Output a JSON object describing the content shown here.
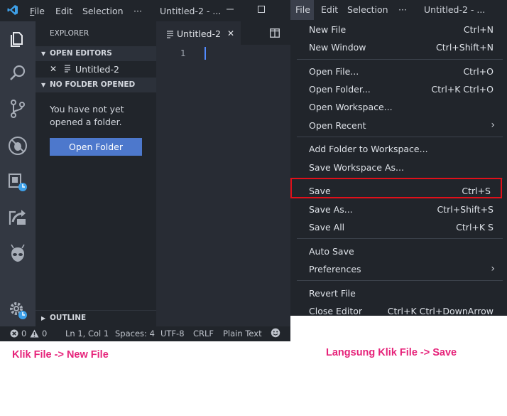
{
  "left_window": {
    "title_menu": [
      "File",
      "Edit",
      "Selection",
      "···",
      "Untitled-2 - ..."
    ],
    "explorer_title": "EXPLORER",
    "sections": {
      "open_editors": "OPEN EDITORS",
      "open_editor_file": "Untitled-2",
      "no_folder": "NO FOLDER OPENED",
      "outline": "OUTLINE"
    },
    "empty_message_line1": "You have not yet",
    "empty_message_line2": "opened a folder.",
    "open_folder_button": "Open Folder",
    "tab_label": "Untitled-2",
    "line_number": "1",
    "status": {
      "errors": "0",
      "warnings": "0",
      "position": "Ln 1, Col 1",
      "spaces": "Spaces: 4",
      "encoding": "UTF-8",
      "eol": "CRLF",
      "language": "Plain Text"
    }
  },
  "right_window": {
    "title_menu": [
      "File",
      "Edit",
      "Selection",
      "···",
      "Untitled-2 - ..."
    ],
    "menu_items": [
      {
        "label": "New File",
        "shortcut": "Ctrl+N"
      },
      {
        "label": "New Window",
        "shortcut": "Ctrl+Shift+N"
      },
      {
        "label": "Open File...",
        "shortcut": "Ctrl+O"
      },
      {
        "label": "Open Folder...",
        "shortcut": "Ctrl+K Ctrl+O"
      },
      {
        "label": "Open Workspace...",
        "shortcut": ""
      },
      {
        "label": "Open Recent",
        "shortcut": ""
      },
      {
        "label": "Add Folder to Workspace...",
        "shortcut": ""
      },
      {
        "label": "Save Workspace As...",
        "shortcut": ""
      },
      {
        "label": "Save",
        "shortcut": "Ctrl+S"
      },
      {
        "label": "Save As...",
        "shortcut": "Ctrl+Shift+S"
      },
      {
        "label": "Save All",
        "shortcut": "Ctrl+K S"
      },
      {
        "label": "Auto Save",
        "shortcut": ""
      },
      {
        "label": "Preferences",
        "shortcut": ""
      },
      {
        "label": "Revert File",
        "shortcut": ""
      },
      {
        "label": "Close Editor",
        "shortcut": "Ctrl+K Ctrl+DownArrow"
      }
    ]
  },
  "captions": {
    "left": "Klik File -> New File",
    "right": "Langsung Klik File -> Save"
  },
  "colors": {
    "highlight_box": "#e0101a",
    "caption": "#e6237a",
    "button": "#4d78cc"
  }
}
